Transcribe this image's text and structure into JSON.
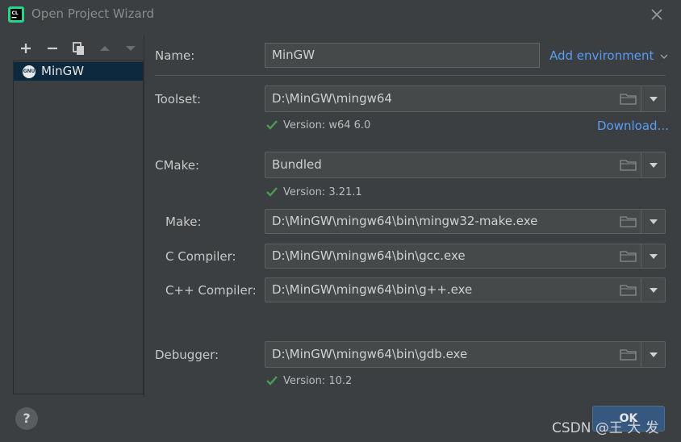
{
  "window": {
    "title": "Open Project Wizard"
  },
  "left": {
    "toolbar": [
      "add-icon",
      "remove-icon",
      "copy-icon",
      "move-up-icon",
      "move-down-icon"
    ],
    "items": [
      {
        "label": "MinGW",
        "badge": "GNU",
        "selected": true
      }
    ]
  },
  "form": {
    "name": {
      "label": "Name:",
      "value": "MinGW"
    },
    "add_env": {
      "label": "Add environment"
    },
    "toolset": {
      "label": "Toolset:",
      "value": "D:\\MinGW\\mingw64",
      "version": "Version: w64 6.0",
      "download": "Download..."
    },
    "cmake": {
      "label": "CMake:",
      "value": "Bundled",
      "version": "Version: 3.21.1"
    },
    "make": {
      "label": "Make:",
      "value": "D:\\MinGW\\mingw64\\bin\\mingw32-make.exe"
    },
    "c_compiler": {
      "label": "C Compiler:",
      "value": "D:\\MinGW\\mingw64\\bin\\gcc.exe"
    },
    "cpp_compiler": {
      "label": "C++ Compiler:",
      "value": "D:\\MinGW\\mingw64\\bin\\g++.exe"
    },
    "debugger": {
      "label": "Debugger:",
      "value": "D:\\MinGW\\mingw64\\bin\\gdb.exe",
      "version": "Version: 10.2"
    }
  },
  "footer": {
    "help": "?",
    "ok": "OK",
    "watermark": "CSDN @王 大 发"
  },
  "colors": {
    "accent_link": "#589df6",
    "check_green": "#499c54",
    "selection": "#0d293e",
    "ok_button": "#365880"
  }
}
